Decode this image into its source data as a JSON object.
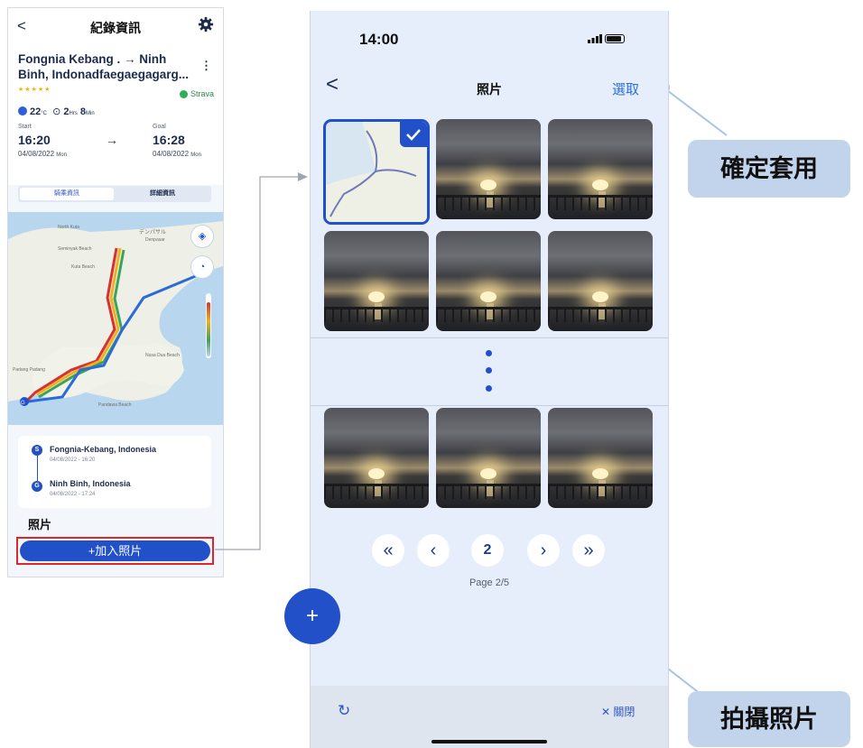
{
  "left_phone": {
    "title": "紀錄資訊",
    "route_title": "Fongnia Kebang . → Ninh Binh, Indonadfaegaegagarg...",
    "stars": "★★★★★",
    "strava_label": "Strava",
    "temp_value": "22",
    "temp_unit": "°C",
    "duration_hours": "2",
    "duration_hours_unit": "Hrs",
    "duration_minutes": "8",
    "duration_minutes_unit": "Min",
    "start_label": "Start",
    "start_time": "16:20",
    "start_date": "04/08/2022",
    "start_day": "Mon",
    "goal_label": "Goal",
    "goal_time": "16:28",
    "goal_date": "04/08/2022",
    "goal_day": "Mon",
    "arrow": "→",
    "tab_summary": "騎乘資訊",
    "tab_detail": "詳細資訊",
    "map_labels": {
      "north_kuta": "North Kuta",
      "denpasar": "デンパサル",
      "denpasar_en": "Denpasar",
      "kuta_beach": "Kuta Beach",
      "seminyak": "Seminyak Beach",
      "padang": "Padang Padang",
      "nusa_dua": "Nusa Dua Beach",
      "pandawa": "Pandawa Beach"
    },
    "location_start_name": "Fongnia-Kebang, Indonesia",
    "location_start_time": "04/08/2022  -  16:20",
    "location_goal_name": "Ninh Binh, Indonesia",
    "location_goal_time": "04/08/2022  -  17:24",
    "pin_start": "S",
    "pin_goal": "G",
    "photos_label": "照片",
    "add_photo_button": "+加入照片"
  },
  "right_phone": {
    "status_time": "14:00",
    "title": "照片",
    "select_button": "選取",
    "current_page": "2",
    "page_indicator": "Page 2/5",
    "pagination": {
      "first": "«",
      "prev": "‹",
      "next": "›",
      "last": "»"
    },
    "fab_label": "+",
    "close_button": "✕ 關閉",
    "refresh_icon": "↻"
  },
  "callouts": {
    "apply": "確定套用",
    "capture": "拍攝照片"
  },
  "colors": {
    "primary": "#2250c9",
    "highlight_border": "#e0262b",
    "callout_bg": "#c2d4ec",
    "phone_bg": "#e7eefb"
  }
}
